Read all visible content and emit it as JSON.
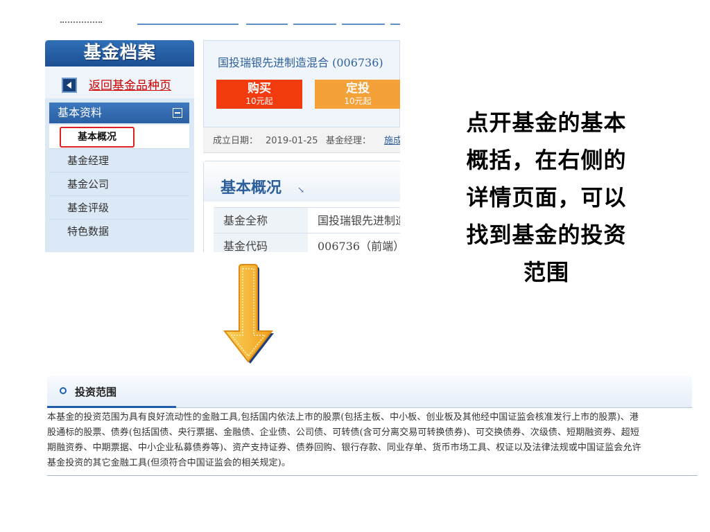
{
  "sidebar": {
    "logo_text": "基金档案",
    "back_link": "返回基金品种页",
    "section_title": "基本资料",
    "active_item": "基本概况",
    "items": [
      "基金经理",
      "基金公司",
      "基金评级",
      "特色数据"
    ]
  },
  "fund": {
    "name": "国投瑞银先进制造混合 (006736)",
    "buy": {
      "label": "购买",
      "sub": "10元起"
    },
    "fixed": {
      "label": "定投",
      "sub": "10元起"
    },
    "established_label": "成立日期：",
    "established_date": "2019-01-25",
    "manager_label": "基金经理：",
    "manager_name": "施成"
  },
  "overview": {
    "title": "基本概况",
    "arrow": "↘",
    "rows": [
      {
        "key": "基金全称",
        "value": "国投瑞银先进制造混合"
      },
      {
        "key": "基金代码",
        "value": "006736（前端）"
      }
    ]
  },
  "annotation": {
    "lines": [
      "点开基金的基本",
      "概括，在右侧的",
      "详情页面，可以",
      "找到基金的投资",
      "范围"
    ]
  },
  "scope": {
    "title": "投资范围",
    "lines": [
      "本基金的投资范围为具有良好流动性的金融工具,包括国内依法上市的股票(包括主板、中小板、创业板及其他经中国证监会核准发行上市的股票)、港",
      "股通标的股票、债券(包括国债、央行票据、金融债、企业债、公司债、可转债(含可分离交易可转换债券)、可交换债券、次级债、短期融资券、超短",
      "期融资券、中期票据、中小企业私募债券等)、资产支持证券、债券回购、银行存款、同业存单、货币市场工具、权证以及法律法规或中国证监会允许",
      "基金投资的其它金融工具(但须符合中国证监会的相关规定)。"
    ]
  },
  "colors": {
    "primary_blue": "#2d5f9c",
    "buy_red": "#f23b0f",
    "fixed_orange": "#f5a13a",
    "arrow_orange": "#f5a623"
  }
}
